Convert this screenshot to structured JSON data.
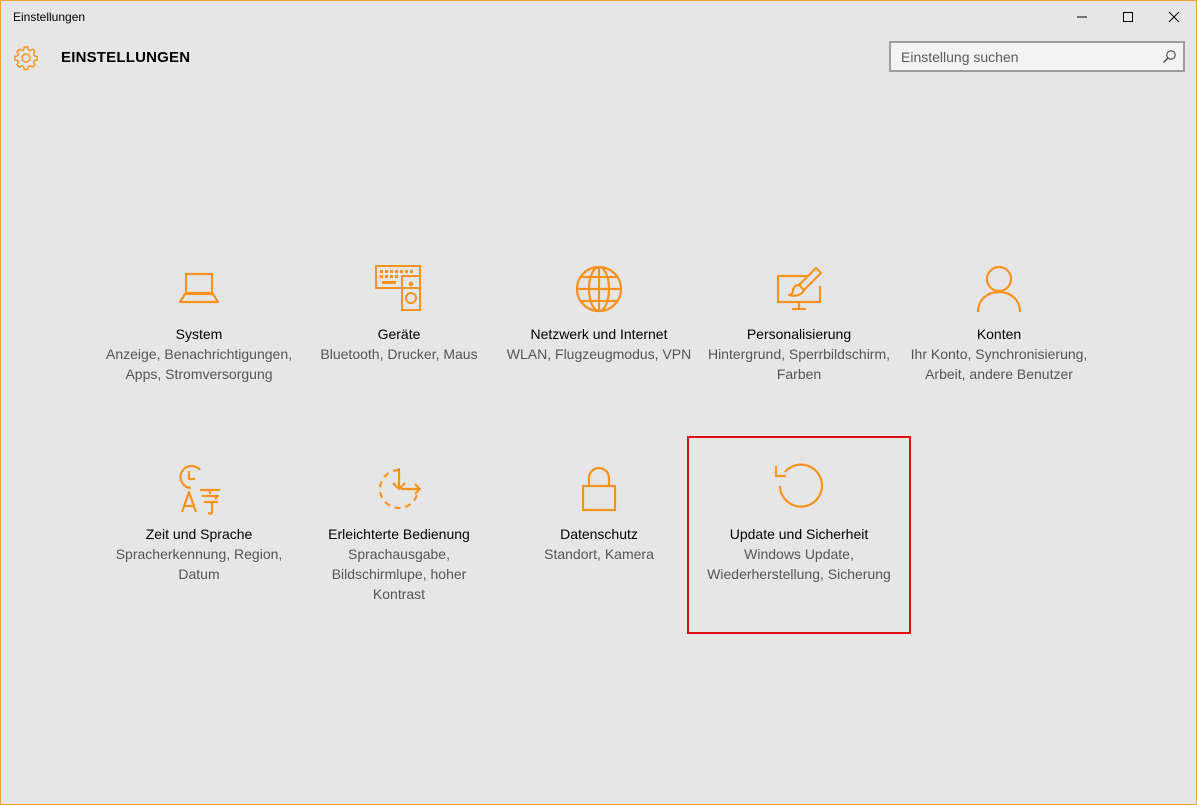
{
  "window": {
    "title": "Einstellungen"
  },
  "header": {
    "title": "EINSTELLUNGEN",
    "icon": "gear-icon"
  },
  "search": {
    "placeholder": "Einstellung suchen",
    "value": "",
    "icon": "search-icon"
  },
  "colors": {
    "accent": "#f7931e",
    "background": "#e6e6e6",
    "highlight_border": "#e01010",
    "window_border": "#f0a030"
  },
  "categories": [
    {
      "label": "System",
      "description": "Anzeige, Benachrichtigungen, Apps, Stromversorgung",
      "icon": "laptop-icon"
    },
    {
      "label": "Geräte",
      "description": "Bluetooth, Drucker, Maus",
      "icon": "devices-icon"
    },
    {
      "label": "Netzwerk und Internet",
      "description": "WLAN, Flugzeugmodus, VPN",
      "icon": "globe-icon"
    },
    {
      "label": "Personalisierung",
      "description": "Hintergrund, Sperrbildschirm, Farben",
      "icon": "personalization-icon"
    },
    {
      "label": "Konten",
      "description": "Ihr Konto, Synchronisierung, Arbeit, andere Benutzer",
      "icon": "person-icon"
    },
    {
      "label": "Zeit und Sprache",
      "description": "Spracherkennung, Region, Datum",
      "icon": "time-language-icon"
    },
    {
      "label": "Erleichterte Bedienung",
      "description": "Sprachausgabe, Bildschirmlupe, hoher Kontrast",
      "icon": "ease-of-access-icon"
    },
    {
      "label": "Datenschutz",
      "description": "Standort, Kamera",
      "icon": "lock-icon"
    },
    {
      "label": "Update und Sicherheit",
      "description": "Windows Update, Wiederherstellung, Sicherung",
      "icon": "update-icon",
      "highlighted": true
    }
  ]
}
